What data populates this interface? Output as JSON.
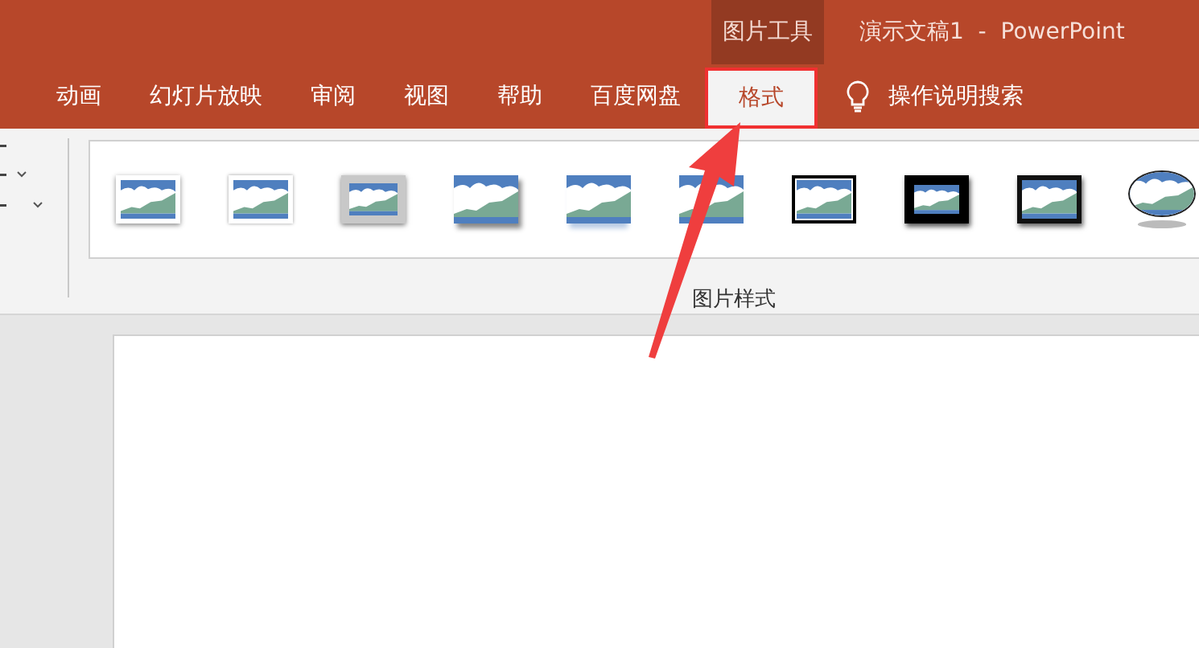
{
  "title_bar": {
    "context_group": "图片工具",
    "title": "演示文稿1  -  PowerPoint"
  },
  "tabs": [
    {
      "label": "动画",
      "selected": false
    },
    {
      "label": "幻灯片放映",
      "selected": false
    },
    {
      "label": "审阅",
      "selected": false
    },
    {
      "label": "视图",
      "selected": false
    },
    {
      "label": "帮助",
      "selected": false
    },
    {
      "label": "百度网盘",
      "selected": false
    },
    {
      "label": "格式",
      "selected": true
    }
  ],
  "tell_me": {
    "placeholder": "操作说明搜索"
  },
  "ribbon": {
    "group_label": "图片样式",
    "styles": [
      {
        "kind": "white-frame"
      },
      {
        "kind": "soft-frame"
      },
      {
        "kind": "gray-matte"
      },
      {
        "kind": "shadow"
      },
      {
        "kind": "reflection"
      },
      {
        "kind": "soft-edge"
      },
      {
        "kind": "double-black"
      },
      {
        "kind": "thick-black"
      },
      {
        "kind": "black-frame"
      },
      {
        "kind": "oval"
      }
    ]
  },
  "annotation": {
    "highlighted_tab": true
  }
}
